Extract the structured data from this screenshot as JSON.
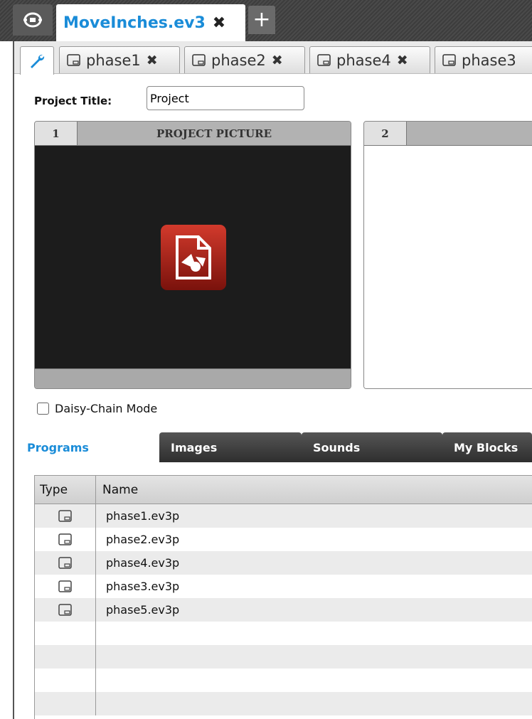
{
  "topbar": {
    "home_icon": "lobby-icon",
    "project_tab": {
      "name": "MoveInches.ev3",
      "close": "✖"
    },
    "add_icon": "plus-icon",
    "add_label": "+"
  },
  "program_tabs": {
    "settings_icon": "wrench-icon",
    "tabs": [
      {
        "label": "phase1",
        "close": "✖"
      },
      {
        "label": "phase2",
        "close": "✖"
      },
      {
        "label": "phase4",
        "close": "✖"
      },
      {
        "label": "phase3",
        "close": ""
      }
    ]
  },
  "project": {
    "title_label": "Project Title:",
    "title_value": "Project"
  },
  "pictures": [
    {
      "number": "1",
      "title": "PROJECT PICTURE"
    },
    {
      "number": "2",
      "title": ""
    }
  ],
  "daisy_chain": {
    "label": "Daisy-Chain Mode",
    "checked": false
  },
  "lower_tabs": [
    {
      "label": "Programs",
      "active": true
    },
    {
      "label": "Images",
      "active": false
    },
    {
      "label": "Sounds",
      "active": false
    },
    {
      "label": "My Blocks",
      "active": false
    }
  ],
  "table": {
    "headers": {
      "type": "Type",
      "name": "Name"
    },
    "rows": [
      {
        "type_icon": "program-icon",
        "name": "phase1.ev3p"
      },
      {
        "type_icon": "program-icon",
        "name": "phase2.ev3p"
      },
      {
        "type_icon": "program-icon",
        "name": "phase4.ev3p"
      },
      {
        "type_icon": "program-icon",
        "name": "phase3.ev3p"
      },
      {
        "type_icon": "program-icon",
        "name": "phase5.ev3p"
      }
    ]
  },
  "colors": {
    "accent": "#1a8cd8",
    "picture_icon": "#c0281c",
    "dark_bar": "#3d3d3d"
  }
}
